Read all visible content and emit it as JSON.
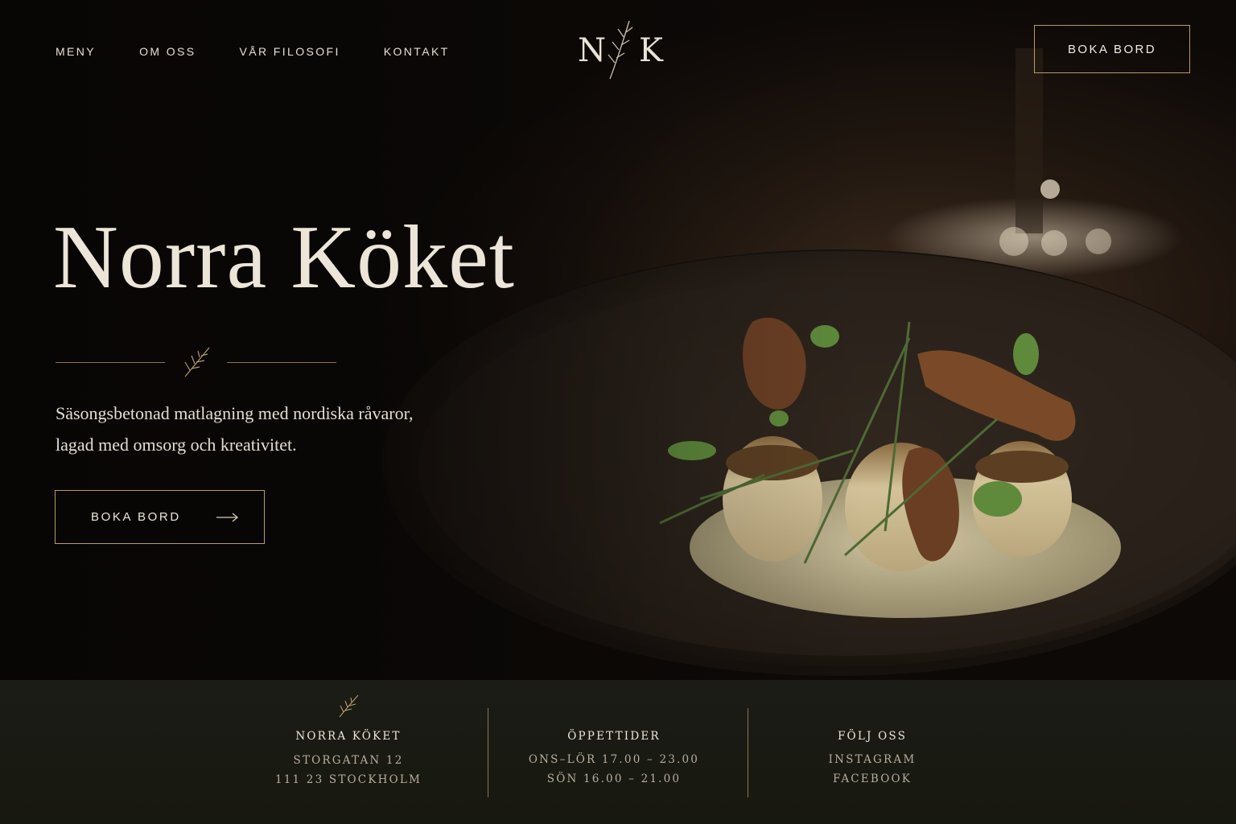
{
  "header": {
    "nav": [
      "MENY",
      "OM OSS",
      "VÅR FILOSOFI",
      "KONTAKT"
    ],
    "logo": {
      "left": "N",
      "right": "K",
      "icon": "sprig-icon"
    },
    "cta_label": "BOKA BORD"
  },
  "hero": {
    "title": "Norra Köket",
    "divider_icon": "sprig-icon",
    "description": "Säsongsbetonad matlagning med nordiska råvaror, lagad med omsorg och kreativitet.",
    "cta_label": "BOKA BORD",
    "cta_icon": "arrow-right-icon",
    "image": "plated-dish-photo"
  },
  "info": {
    "restaurant": {
      "title": "NORRA KÖKET",
      "lines": [
        "STORGATAN 12",
        "111 23 STOCKHOLM"
      ],
      "icon": "sprig-icon"
    },
    "hours": {
      "title": "ÖPPETTIDER",
      "lines": [
        "ONS–LÖR 17.00 – 23.00",
        "SÖN 16.00 – 21.00"
      ]
    },
    "social": {
      "title": "FÖLJ OSS",
      "links": [
        "INSTAGRAM",
        "FACEBOOK"
      ]
    }
  },
  "colors": {
    "background": "#0b0807",
    "accent": "#b79a6c",
    "text": "#ece5d8",
    "footer_bg": "#1b1c16"
  }
}
